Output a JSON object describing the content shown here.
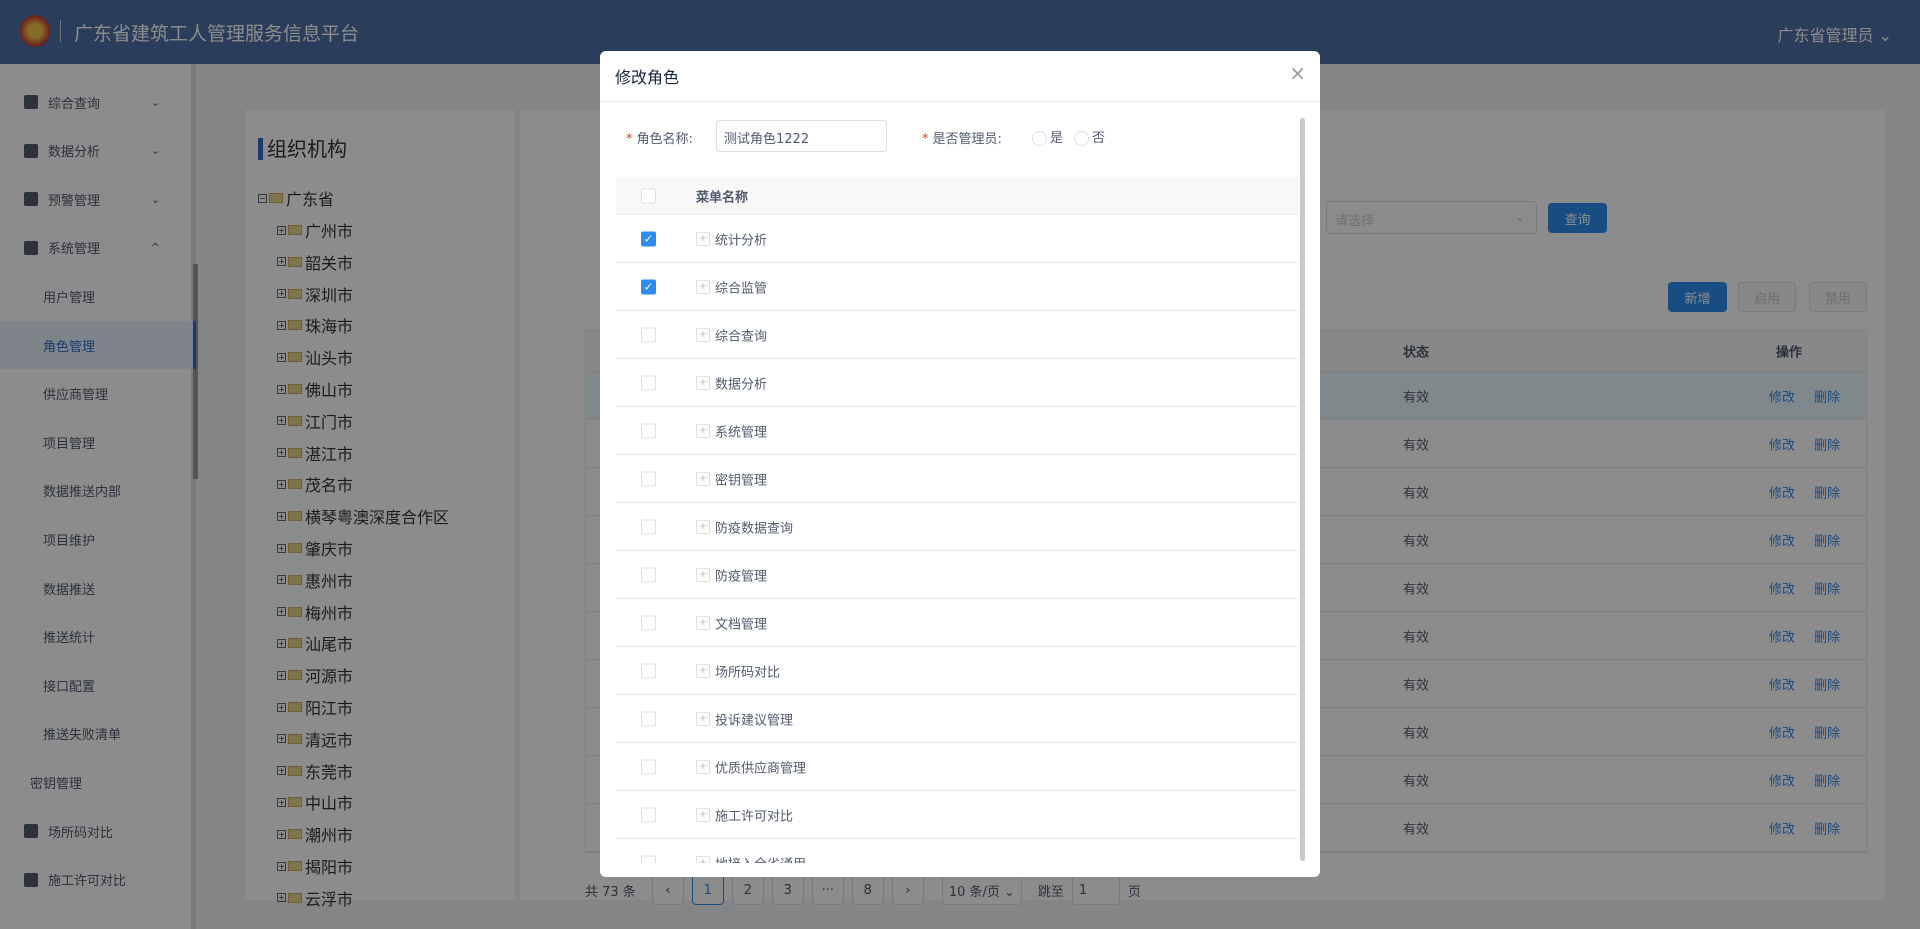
{
  "header": {
    "title": "广东省建筑工人管理服务信息平台",
    "user": "广东省管理员"
  },
  "sidebar": {
    "items": [
      {
        "label": "综合查询",
        "icon": "search-doc-icon",
        "chevron": "⌄"
      },
      {
        "label": "数据分析",
        "icon": "chart-icon",
        "chevron": "⌄"
      },
      {
        "label": "预警管理",
        "icon": "alarm-icon",
        "chevron": "⌄"
      },
      {
        "label": "系统管理",
        "icon": "gear-icon",
        "chevron": "^"
      },
      {
        "label": "用户管理",
        "sub": true
      },
      {
        "label": "角色管理",
        "sub": true,
        "active": true
      },
      {
        "label": "供应商管理",
        "sub": true
      },
      {
        "label": "项目管理",
        "sub": true
      },
      {
        "label": "数据推送内部",
        "sub": true
      },
      {
        "label": "项目维护",
        "sub": true
      },
      {
        "label": "数据推送",
        "sub": true
      },
      {
        "label": "推送统计",
        "sub": true
      },
      {
        "label": "接口配置",
        "sub": true
      },
      {
        "label": "推送失败清单",
        "sub": true
      },
      {
        "label": "密钥管理",
        "plain": true
      },
      {
        "label": "场所码对比",
        "icon": "qrcode-icon"
      },
      {
        "label": "施工许可对比",
        "icon": "permit-icon"
      }
    ]
  },
  "tree": {
    "title": "组织机构",
    "root": "广东省",
    "children": [
      "广州市",
      "韶关市",
      "深圳市",
      "珠海市",
      "汕头市",
      "佛山市",
      "江门市",
      "湛江市",
      "茂名市",
      "横琴粤澳深度合作区",
      "肇庆市",
      "惠州市",
      "梅州市",
      "汕尾市",
      "河源市",
      "阳江市",
      "清远市",
      "东莞市",
      "中山市",
      "潮州市",
      "揭阳市",
      "云浮市"
    ]
  },
  "main": {
    "select_placeholder": "请选择",
    "query": "查询",
    "add": "新增",
    "enable": "启用",
    "disable": "禁用",
    "columns": {
      "status": "状态",
      "action": "操作"
    },
    "rows": [
      "有效",
      "有效",
      "有效",
      "有效",
      "有效",
      "有效",
      "有效",
      "有效",
      "有效",
      "有效"
    ],
    "edit": "修改",
    "delete": "删除",
    "pager": {
      "total": "共 73 条",
      "prev": "‹",
      "pages": [
        "1",
        "2",
        "3",
        "···",
        "8"
      ],
      "current": "1",
      "next": "›",
      "size": "10 条/页 ⌄",
      "jump": "跳至",
      "jump_value": "1",
      "page": "页"
    }
  },
  "modal": {
    "title": "修改角色",
    "close": "×",
    "name_label": "角色名称:",
    "name_value": "测试角色1222",
    "admin_label": "是否管理员:",
    "yes": "是",
    "no": "否",
    "col_menu": "菜单名称",
    "menus": [
      {
        "label": "统计分析",
        "checked": true
      },
      {
        "label": "综合监管",
        "checked": true
      },
      {
        "label": "综合查询",
        "checked": false
      },
      {
        "label": "数据分析",
        "checked": false
      },
      {
        "label": "系统管理",
        "checked": false
      },
      {
        "label": "密钥管理",
        "checked": false
      },
      {
        "label": "防疫数据查询",
        "checked": false
      },
      {
        "label": "防疫管理",
        "checked": false
      },
      {
        "label": "文档管理",
        "checked": false
      },
      {
        "label": "场所码对比",
        "checked": false
      },
      {
        "label": "投诉建议管理",
        "checked": false
      },
      {
        "label": "优质供应商管理",
        "checked": false
      },
      {
        "label": "施工许可对比",
        "checked": false
      },
      {
        "label": "地接入全省通用",
        "checked": false
      }
    ]
  }
}
